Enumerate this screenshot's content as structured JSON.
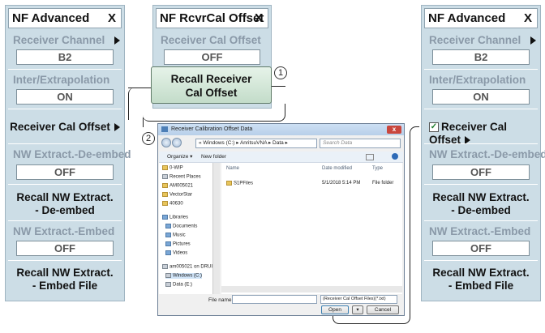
{
  "left_panel": {
    "title": "NF Advanced",
    "close": "X",
    "receiver_channel_label": "Receiver Channel",
    "receiver_channel_value": "B2",
    "inter_label": "Inter/Extrapolation",
    "inter_value": "ON",
    "receiver_cal_offset": "Receiver Cal Offset",
    "nw_deembed_label": "NW Extract.-De-embed",
    "nw_deembed_value": "OFF",
    "recall_deembed_1": "Recall NW Extract.",
    "recall_deembed_2": "- De-embed",
    "nw_embed_label": "NW Extract.-Embed",
    "nw_embed_value": "OFF",
    "recall_embed_1": "Recall NW Extract.",
    "recall_embed_2": "- Embed File"
  },
  "middle_panel": {
    "title": "NF RcvrCal Offset",
    "close": "X",
    "offset_label": "Receiver Cal Offset",
    "offset_value": "OFF",
    "recall_1": "Recall Receiver",
    "recall_2": "Cal Offset"
  },
  "right_panel": {
    "title": "NF Advanced",
    "close": "X",
    "receiver_channel_label": "Receiver Channel",
    "receiver_channel_value": "B2",
    "inter_label": "Inter/Extrapolation",
    "inter_value": "ON",
    "receiver_cal_offset": "Receiver Cal Offset",
    "nw_deembed_label": "NW Extract.-De-embed",
    "nw_deembed_value": "OFF",
    "recall_deembed_1": "Recall NW Extract.",
    "recall_deembed_2": "- De-embed",
    "nw_embed_label": "NW Extract.-Embed",
    "nw_embed_value": "OFF",
    "recall_embed_1": "Recall NW Extract.",
    "recall_embed_2": "- Embed File"
  },
  "callouts": {
    "one": "1",
    "two": "2"
  },
  "dialog": {
    "title": "Receiver Calibration Offset Data",
    "close": "x",
    "address": "« Windows (C:) ▸ AnritsuVNA ▸ Data ▸",
    "search_placeholder": "Search Data",
    "organize": "Organize ▾",
    "new_folder": "New folder",
    "nav_items": [
      "0-WIP",
      "Recent Places",
      "AM005021",
      "VectorStar",
      "40630",
      "Libraries",
      "Documents",
      "Music",
      "Pictures",
      "Videos",
      "am005021 on DRUI",
      "Windows (C:)",
      "Data (E:)"
    ],
    "col_name": "Name",
    "col_date": "Date modified",
    "col_type": "Type",
    "file_name": "S1PFiles",
    "file_date": "5/1/2018 5:14 PM",
    "file_type": "File folder",
    "filename_label": "File name:",
    "filetype": "(Receiver Cal Offset Files)(*.txt)",
    "open": "Open",
    "cancel": "Cancel"
  }
}
